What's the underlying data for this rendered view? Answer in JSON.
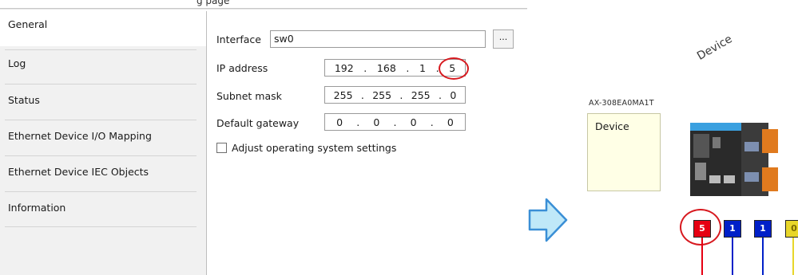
{
  "header": {
    "fragment_text": "g                    page"
  },
  "tabs": [
    {
      "label": "General",
      "selected": true
    },
    {
      "label": "Log"
    },
    {
      "label": "Status"
    },
    {
      "label": "Ethernet Device I/O Mapping"
    },
    {
      "label": "Ethernet Device IEC Objects"
    },
    {
      "label": "Information"
    }
  ],
  "general": {
    "interface_label": "Interface",
    "interface_value": "sw0",
    "browse_label": "...",
    "ip_label": "IP address",
    "ip": [
      "192",
      "168",
      "1",
      "5"
    ],
    "subnet_label": "Subnet mask",
    "subnet": [
      "255",
      "255",
      "255",
      "0"
    ],
    "gateway_label": "Default gateway",
    "gateway": [
      "0",
      "0",
      "0",
      "0"
    ],
    "adjust_label": "Adjust operating system settings",
    "adjust_checked": false
  },
  "device": {
    "heading": "Device",
    "model": "AX-308EA0MA1T",
    "box_label": "Device",
    "ports": [
      "5",
      "1",
      "1",
      "0"
    ]
  },
  "colors": {
    "highlight": "#d7191f",
    "arrow_fill": "#bfe8f8",
    "arrow_stroke": "#3a8fd6",
    "port_red": "#e60012",
    "port_blue": "#0020c8",
    "port_yellow": "#e8d62a"
  }
}
